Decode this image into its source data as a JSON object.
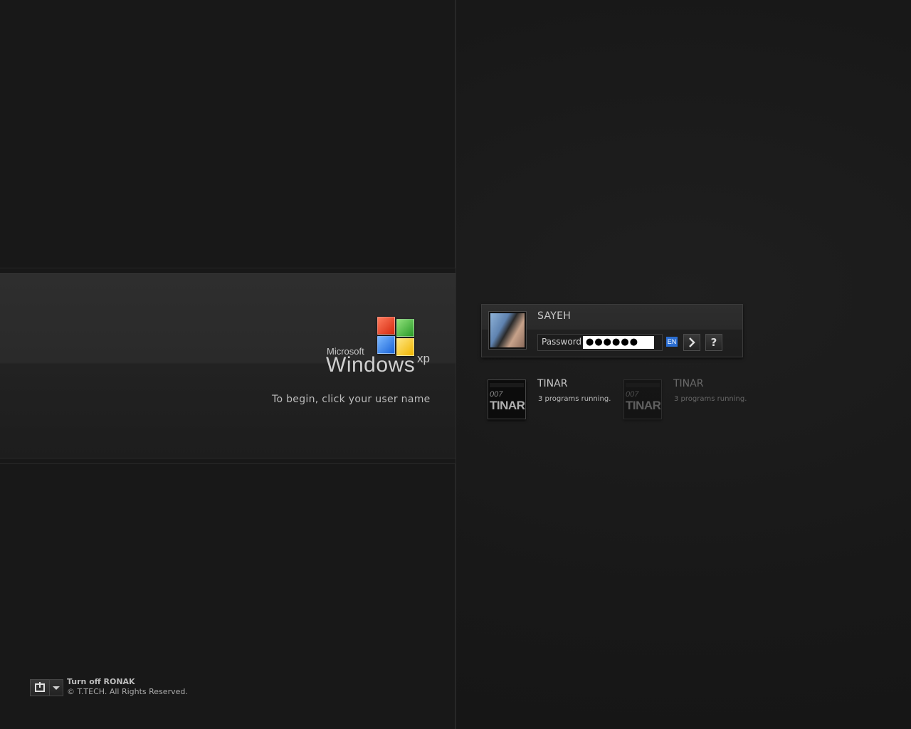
{
  "logo": {
    "microsoft": "Microsoft",
    "windows": "Windows",
    "xp": "xp",
    "flag_colors": [
      "#e8361b",
      "#3fbf32",
      "#2d7ff0",
      "#ffc814"
    ]
  },
  "prompt": "To begin, click your user name",
  "active_user": {
    "name": "SAYEH",
    "password_label": "Password",
    "password_value": "●●●●●●",
    "language": "EN",
    "go_icon": "chevron-right-icon",
    "help_label": "?"
  },
  "sessions": [
    {
      "name": "TINAR",
      "status": "3 programs running.",
      "icon_number": "007",
      "icon_word": "TINAR"
    },
    {
      "name": "TINAR",
      "status": "3 programs running.",
      "icon_number": "007",
      "icon_word": "TINAR"
    }
  ],
  "footer": {
    "turn_off": "Turn off RONAK",
    "copyright": "© T.TECH. All Rights Reserved.",
    "power_icon": "power-icon",
    "dropdown_icon": "chevron-down-icon"
  }
}
